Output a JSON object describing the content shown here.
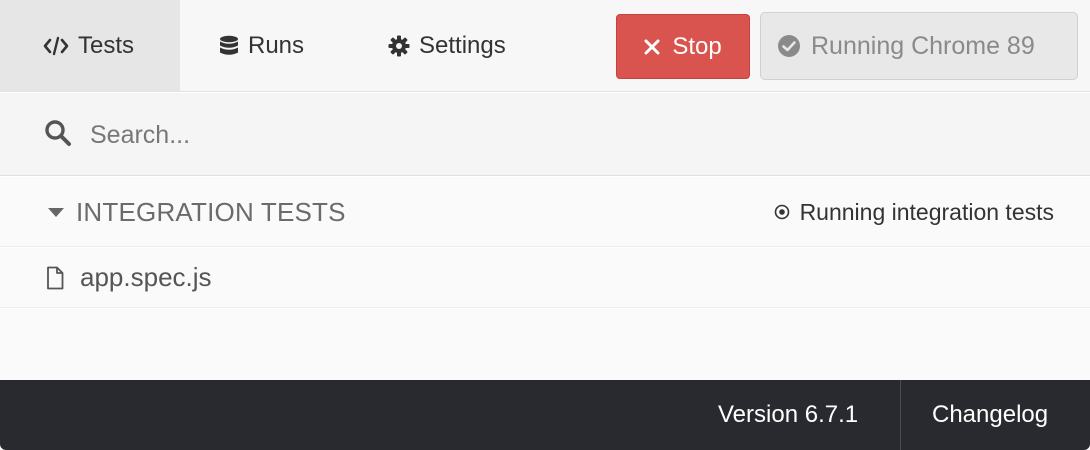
{
  "nav": {
    "tabs": [
      {
        "label": "Tests",
        "icon": "code-icon",
        "active": true
      },
      {
        "label": "Runs",
        "icon": "database-icon",
        "active": false
      },
      {
        "label": "Settings",
        "icon": "gear-icon",
        "active": false
      }
    ],
    "stop_label": "Stop",
    "browser_label": "Running Chrome 89"
  },
  "search": {
    "placeholder": "Search...",
    "value": ""
  },
  "specs": {
    "folder_title": "INTEGRATION TESTS",
    "folder_status": "Running integration tests",
    "files": [
      {
        "name": "app.spec.js"
      }
    ]
  },
  "footer": {
    "version": "Version 6.7.1",
    "changelog": "Changelog"
  },
  "colors": {
    "stop_button": "#d9534f",
    "footer_bg": "#292a2f",
    "nav_bg": "#f7f7f7"
  }
}
